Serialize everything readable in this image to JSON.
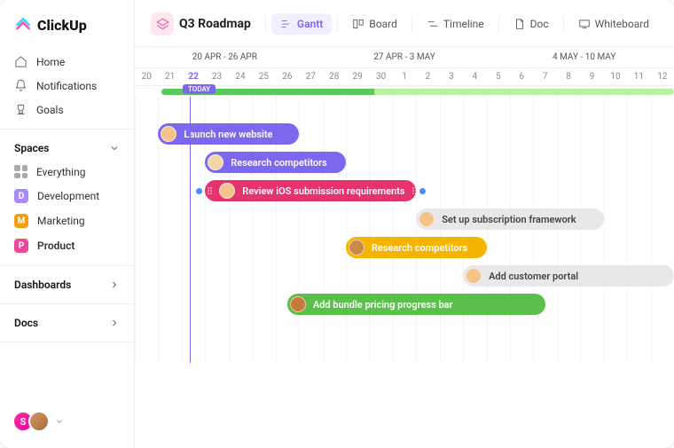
{
  "brand": {
    "name": "ClickUp"
  },
  "sidebar": {
    "nav": [
      {
        "label": "Home",
        "icon": "home-icon"
      },
      {
        "label": "Notifications",
        "icon": "bell-icon"
      },
      {
        "label": "Goals",
        "icon": "trophy-icon"
      }
    ],
    "sections": {
      "spaces": {
        "label": "Spaces"
      },
      "dashboards": {
        "label": "Dashboards"
      },
      "docs": {
        "label": "Docs"
      }
    },
    "spaces": [
      {
        "label": "Everything",
        "icon": "grid-icon",
        "color": ""
      },
      {
        "label": "Development",
        "badge": "D",
        "color": "#a78bfa"
      },
      {
        "label": "Marketing",
        "badge": "M",
        "color": "#f59e0b"
      },
      {
        "label": "Product",
        "badge": "P",
        "color": "#ec4899",
        "active": true
      }
    ],
    "bottom_avatar_initial": "S"
  },
  "header": {
    "title": "Q3 Roadmap",
    "views": [
      {
        "label": "Gantt",
        "icon": "gantt-icon",
        "active": true
      },
      {
        "label": "Board",
        "icon": "board-icon"
      },
      {
        "label": "Timeline",
        "icon": "timeline-icon"
      },
      {
        "label": "Doc",
        "icon": "doc-icon"
      },
      {
        "label": "Whiteboard",
        "icon": "whiteboard-icon"
      }
    ]
  },
  "gantt": {
    "weeks": [
      "20 APR - 26 APR",
      "27 APR - 3 MAY",
      "4 MAY - 10 MAY"
    ],
    "days": [
      "20",
      "21",
      "22",
      "23",
      "24",
      "25",
      "26",
      "27",
      "28",
      "29",
      "30",
      "1",
      "2",
      "3",
      "4",
      "5",
      "6",
      "7",
      "8",
      "9",
      "10",
      "11",
      "12"
    ],
    "today_index": 2,
    "today_label": "TODAY",
    "progress_pct": 41,
    "tasks": [
      {
        "label": "Launch new website",
        "color": "#7b68ee",
        "start": 1,
        "span": 6,
        "avatar_bg": "#f6c28b"
      },
      {
        "label": "Research competitors",
        "color": "#7b68ee",
        "start": 3,
        "span": 6,
        "avatar_bg": "#f1d6a8"
      },
      {
        "label": "Review iOS submission requirements",
        "color": "#e6326e",
        "start": 3,
        "span": 9,
        "avatar_bg": "#f4c28b",
        "has_handles": true,
        "dep_before": true,
        "dep_after": true
      },
      {
        "label": "Set up subscription framework",
        "color": "gray",
        "start": 12,
        "span": 8,
        "avatar_bg": "#f4c28b"
      },
      {
        "label": "Research competitors",
        "color": "#f5b400",
        "start": 9,
        "span": 6,
        "avatar_bg": "#c98a46"
      },
      {
        "label": "Add customer portal",
        "color": "gray",
        "start": 14,
        "span": 9,
        "avatar_bg": "#f4c28b"
      },
      {
        "label": "Add bundle pricing progress bar",
        "color": "#5bbf4b",
        "start": 6.5,
        "span": 11,
        "avatar_bg": "#c87b3f"
      }
    ]
  }
}
